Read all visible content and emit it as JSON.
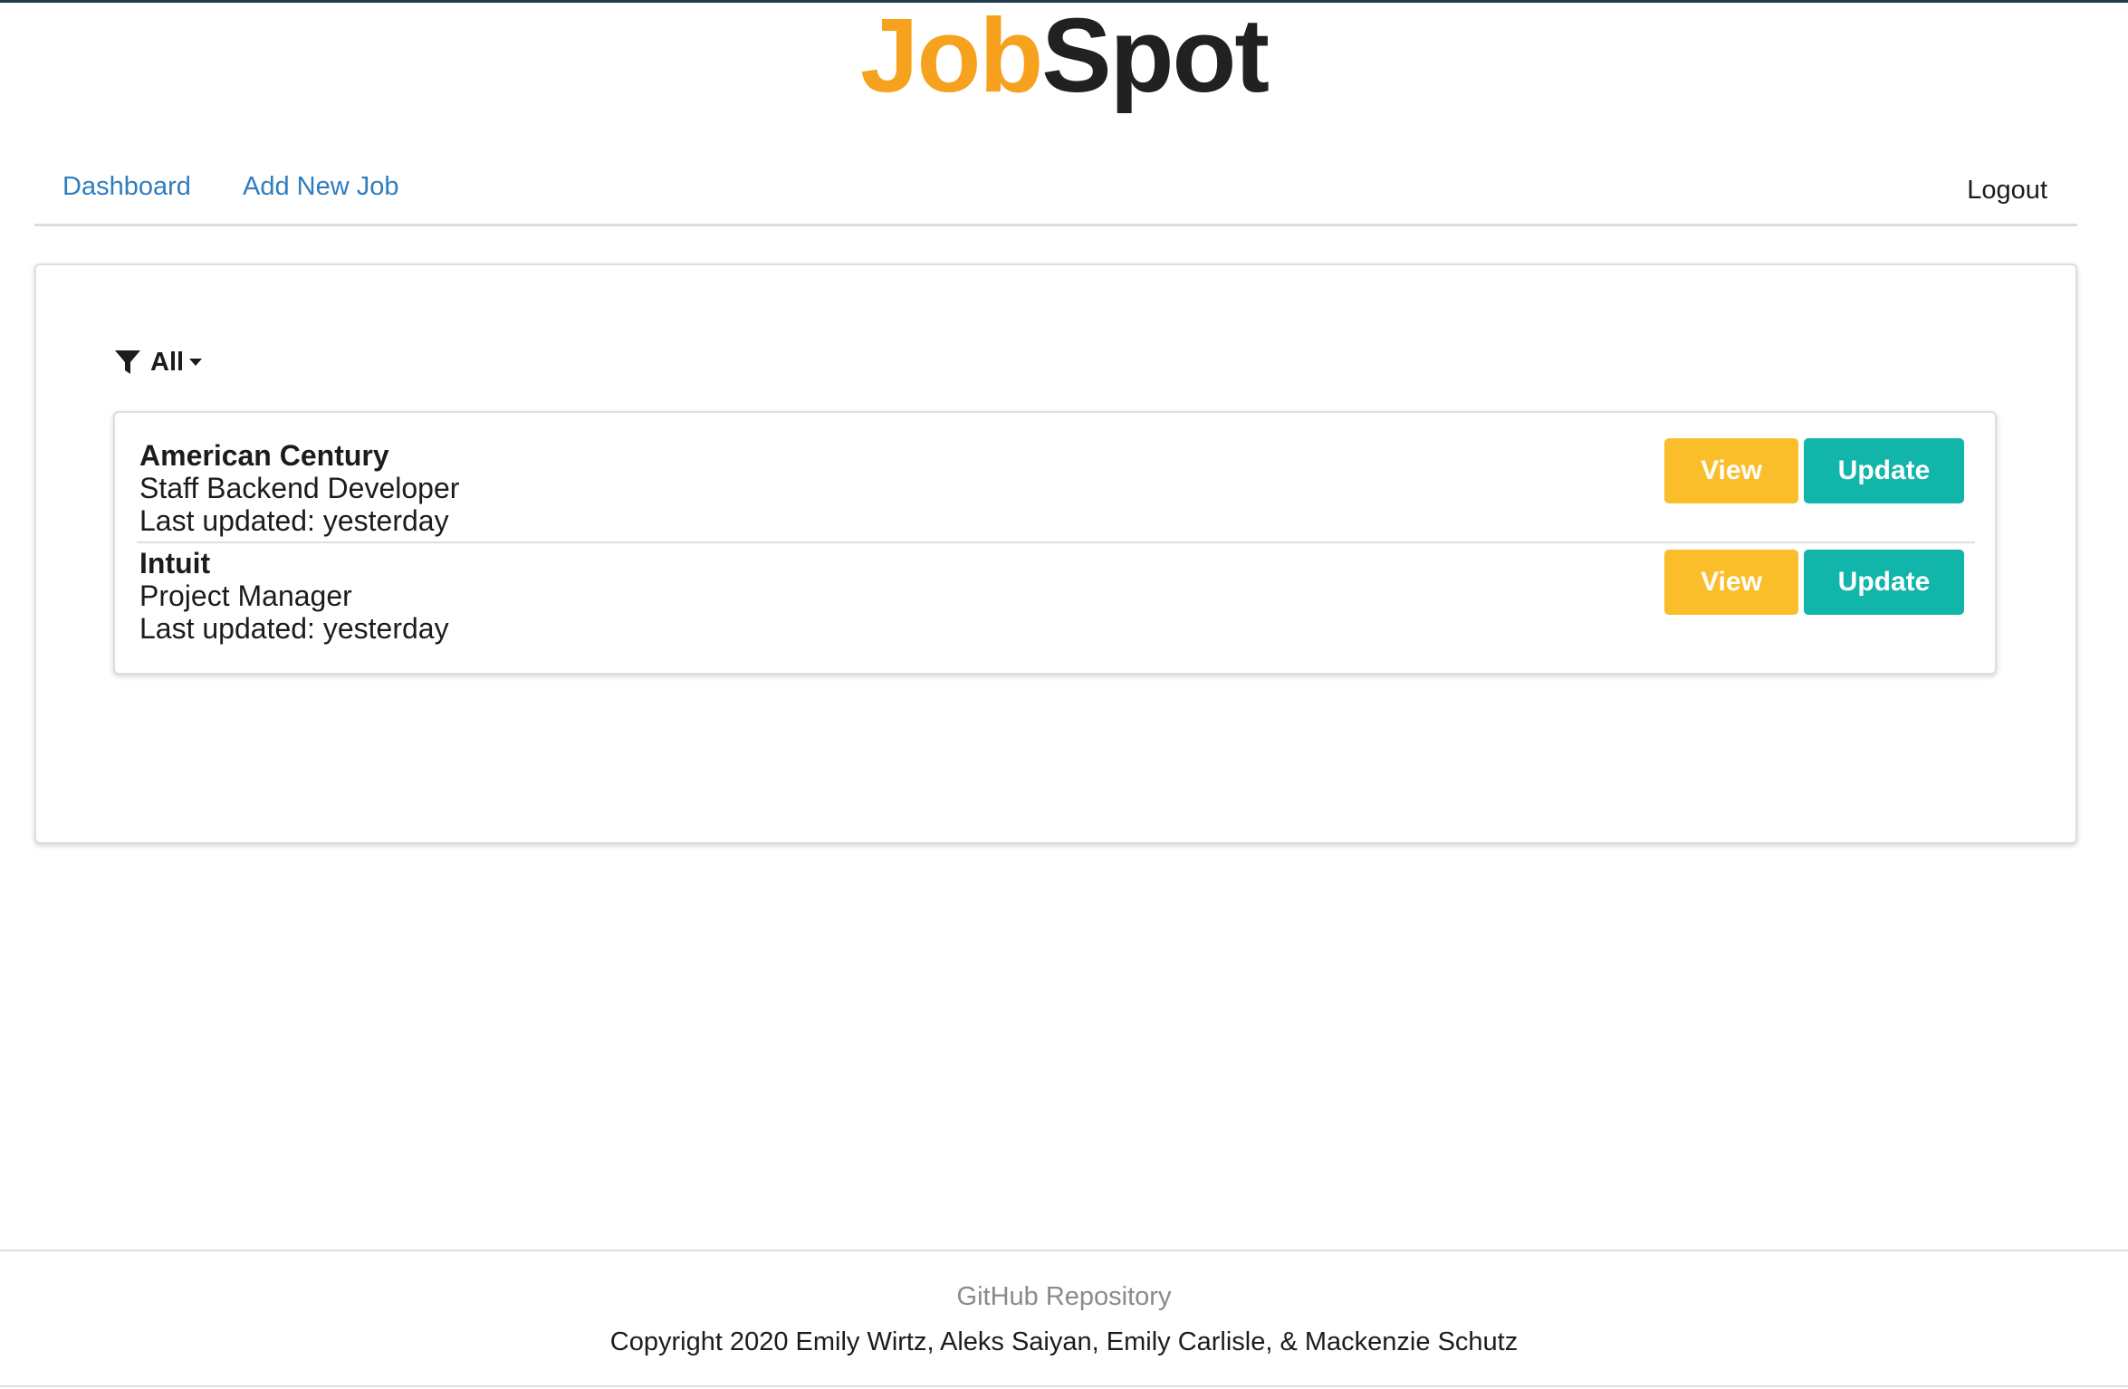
{
  "brand": {
    "part1": "Job",
    "part2": "Spot"
  },
  "nav": {
    "dashboard": "Dashboard",
    "add_new_job": "Add New Job",
    "logout": "Logout"
  },
  "filter": {
    "icon": "filter-icon",
    "label": "All",
    "caret_icon": "caret-down-icon"
  },
  "jobs": [
    {
      "company": "American Century",
      "title": "Staff Backend Developer",
      "updated": "Last updated: yesterday",
      "view_label": "View",
      "update_label": "Update"
    },
    {
      "company": "Intuit",
      "title": "Project Manager",
      "updated": "Last updated: yesterday",
      "view_label": "View",
      "update_label": "Update"
    }
  ],
  "footer": {
    "repo_link": "GitHub Repository",
    "copyright": "Copyright 2020 Emily Wirtz, Aleks Saiyan, Emily Carlisle, & Mackenzie Schutz"
  },
  "colors": {
    "brand_accent": "#f6a21e",
    "link": "#2f7dbf",
    "view_button": "#fbbe2b",
    "update_button": "#12b5aa"
  }
}
